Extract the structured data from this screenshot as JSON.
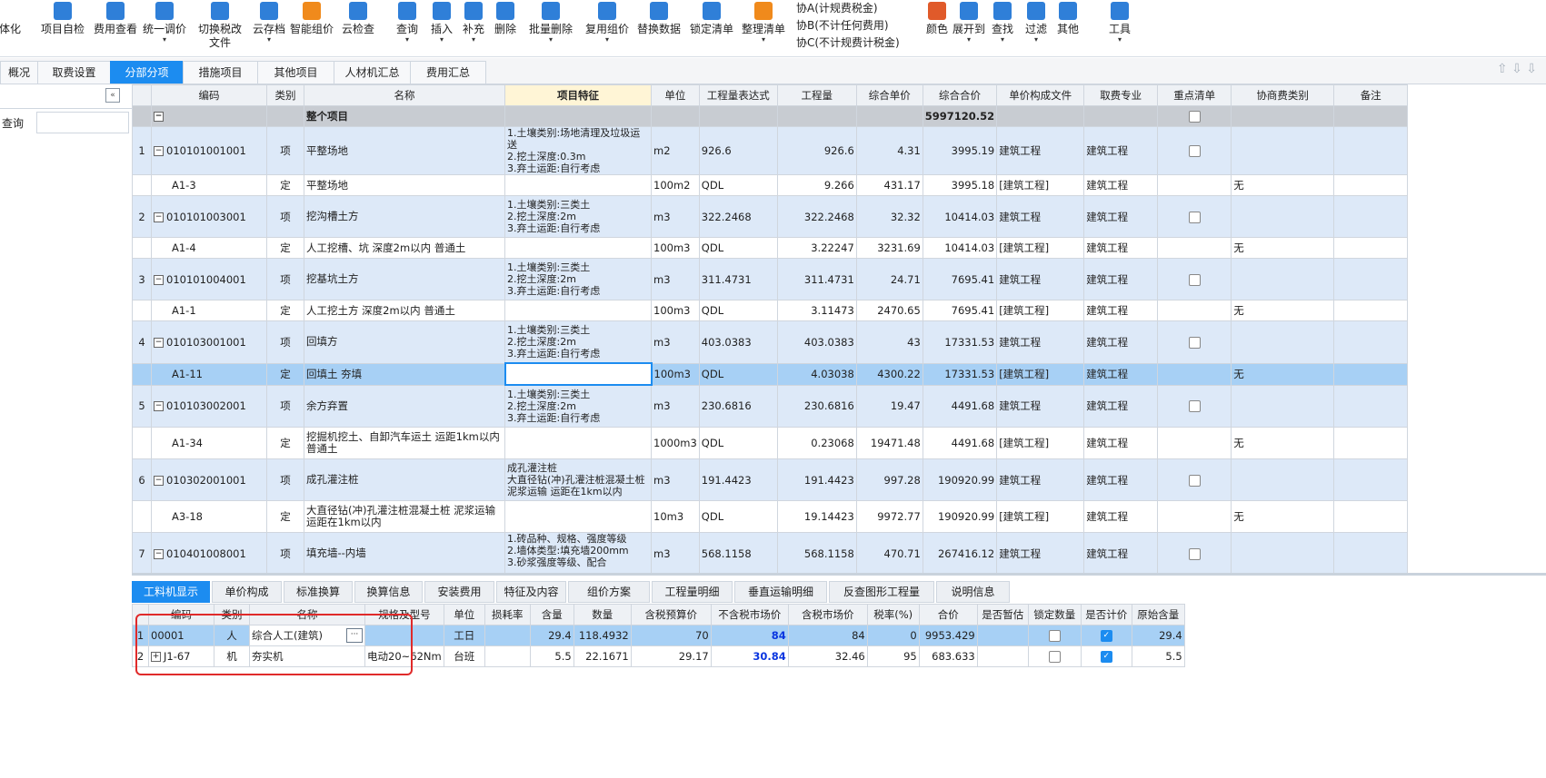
{
  "toolbar": {
    "buttons": [
      {
        "label": "体化",
        "color": "#2f7fd8"
      },
      {
        "label": "项目自检",
        "color": "#2f7fd8"
      },
      {
        "label": "费用查看",
        "color": "#2f7fd8"
      },
      {
        "label": "统一调价",
        "color": "#2f7fd8"
      },
      {
        "label": "切换税改",
        "label2": "文件",
        "color": "#2f7fd8"
      },
      {
        "label": "云存档",
        "color": "#2f7fd8"
      },
      {
        "label": "智能组价",
        "color": "#f08a1c"
      },
      {
        "label": "云检查",
        "color": "#2f7fd8"
      },
      {
        "label": "查询",
        "color": "#2f7fd8"
      },
      {
        "label": "插入",
        "color": "#2f7fd8"
      },
      {
        "label": "补充",
        "color": "#2f7fd8"
      },
      {
        "label": "删除",
        "color": "#2f7fd8"
      },
      {
        "label": "批量删除",
        "color": "#2f7fd8"
      },
      {
        "label": "复用组价",
        "color": "#2f7fd8"
      },
      {
        "label": "替换数据",
        "color": "#2f7fd8"
      },
      {
        "label": "锁定清单",
        "color": "#2f7fd8"
      },
      {
        "label": "整理清单",
        "color": "#f08a1c"
      },
      {
        "label": "颜色",
        "color": "#e05a2a"
      },
      {
        "label": "展开到",
        "color": "#2f7fd8"
      },
      {
        "label": "查找",
        "color": "#2f7fd8"
      },
      {
        "label": "过滤",
        "color": "#2f7fd8"
      },
      {
        "label": "其他",
        "color": "#2f7fd8"
      },
      {
        "label": "工具",
        "color": "#2f7fd8"
      }
    ],
    "xie": [
      "协A(计规费税金)",
      "协B(不计任何费用)",
      "协C(不计规费计税金)"
    ]
  },
  "tabs": [
    "概况",
    "取费设置",
    "分部分项",
    "措施项目",
    "其他项目",
    "人材机汇总",
    "费用汇总"
  ],
  "left_panel": {
    "query_label": "查询",
    "collapse": "«"
  },
  "grid": {
    "headers": [
      "编码",
      "类别",
      "名称",
      "项目特征",
      "单位",
      "工程量表达式",
      "工程量",
      "综合单价",
      "综合合价",
      "单价构成文件",
      "取费专业",
      "重点清单",
      "协商费类别",
      "备注"
    ],
    "total_row": {
      "toggle": "−",
      "name": "整个项目",
      "total": "5997120.52"
    },
    "rows": [
      {
        "idx": "1",
        "code": "010101001001",
        "type": "项",
        "name": "平整场地",
        "feat": "1.土壤类别:场地清理及垃圾运送\n2.挖土深度:0.3m\n3.弃土运距:自行考虑",
        "unit": "m2",
        "expr": "926.6",
        "qty": "926.6",
        "price": "4.31",
        "total": "3995.19",
        "file": "建筑工程",
        "major": "建筑工程"
      },
      {
        "code": "A1-3",
        "type": "定",
        "name": "平整场地",
        "unit": "100m2",
        "expr": "QDL",
        "qty": "9.266",
        "price": "431.17",
        "total": "3995.18",
        "file": "[建筑工程]",
        "major": "建筑工程",
        "xie": "无"
      },
      {
        "idx": "2",
        "code": "010101003001",
        "type": "项",
        "name": "挖沟槽土方",
        "feat": "1.土壤类别:三类土\n2.挖土深度:2m\n3.弃土运距:自行考虑",
        "unit": "m3",
        "expr": "322.2468",
        "qty": "322.2468",
        "price": "32.32",
        "total": "10414.03",
        "file": "建筑工程",
        "major": "建筑工程"
      },
      {
        "code": "A1-4",
        "type": "定",
        "name": "人工挖槽、坑 深度2m以内 普通土",
        "unit": "100m3",
        "expr": "QDL",
        "qty": "3.22247",
        "price": "3231.69",
        "total": "10414.03",
        "file": "[建筑工程]",
        "major": "建筑工程",
        "xie": "无"
      },
      {
        "idx": "3",
        "code": "010101004001",
        "type": "项",
        "name": "挖基坑土方",
        "feat": "1.土壤类别:三类土\n2.挖土深度:2m\n3.弃土运距:自行考虑",
        "unit": "m3",
        "expr": "311.4731",
        "qty": "311.4731",
        "price": "24.71",
        "total": "7695.41",
        "file": "建筑工程",
        "major": "建筑工程"
      },
      {
        "code": "A1-1",
        "type": "定",
        "name": "人工挖土方 深度2m以内 普通土",
        "unit": "100m3",
        "expr": "QDL",
        "qty": "3.11473",
        "price": "2470.65",
        "total": "7695.41",
        "file": "[建筑工程]",
        "major": "建筑工程",
        "xie": "无"
      },
      {
        "idx": "4",
        "code": "010103001001",
        "type": "项",
        "name": "回填方",
        "feat": "1.土壤类别:三类土\n2.挖土深度:2m\n3.弃土运距:自行考虑",
        "unit": "m3",
        "expr": "403.0383",
        "qty": "403.0383",
        "price": "43",
        "total": "17331.53",
        "file": "建筑工程",
        "major": "建筑工程"
      },
      {
        "code": "A1-11",
        "type": "定",
        "name": "回填土 夯填",
        "unit": "100m3",
        "expr": "QDL",
        "qty": "4.03038",
        "price": "4300.22",
        "total": "17331.53",
        "file": "[建筑工程]",
        "major": "建筑工程",
        "xie": "无",
        "selected": true
      },
      {
        "idx": "5",
        "code": "010103002001",
        "type": "项",
        "name": "余方弃置",
        "feat": "1.土壤类别:三类土\n2.挖土深度:2m\n3.弃土运距:自行考虑",
        "unit": "m3",
        "expr": "230.6816",
        "qty": "230.6816",
        "price": "19.47",
        "total": "4491.68",
        "file": "建筑工程",
        "major": "建筑工程"
      },
      {
        "code": "A1-34",
        "type": "定",
        "name": "挖掘机挖土、自卸汽车运土 运距1km以内 普通土",
        "unit": "1000m3",
        "expr": "QDL",
        "qty": "0.23068",
        "price": "19471.48",
        "total": "4491.68",
        "file": "[建筑工程]",
        "major": "建筑工程",
        "xie": "无",
        "tall": true
      },
      {
        "idx": "6",
        "code": "010302001001",
        "type": "项",
        "name": "成孔灌注桩",
        "feat": "成孔灌注桩\n大直径钻(冲)孔灌注桩混凝土桩 泥浆运输 运距在1km以内",
        "unit": "m3",
        "expr": "191.4423",
        "qty": "191.4423",
        "price": "997.28",
        "total": "190920.99",
        "file": "建筑工程",
        "major": "建筑工程"
      },
      {
        "code": "A3-18",
        "type": "定",
        "name": "大直径钻(冲)孔灌注桩混凝土桩 泥浆运输 运距在1km以内",
        "unit": "10m3",
        "expr": "QDL",
        "qty": "19.14423",
        "price": "9972.77",
        "total": "190920.99",
        "file": "[建筑工程]",
        "major": "建筑工程",
        "xie": "无",
        "tall": true
      },
      {
        "idx": "7",
        "code": "010401008001",
        "type": "项",
        "name": "填充墙--内墙",
        "feat": "1.砖品种、规格、强度等级\n2.墙体类型:填充墙200mm\n3.砂浆强度等级、配合",
        "unit": "m3",
        "expr": "568.1158",
        "qty": "568.1158",
        "price": "470.71",
        "total": "267416.12",
        "file": "建筑工程",
        "major": "建筑工程"
      }
    ]
  },
  "bottom_tabs": [
    "工料机显示",
    "单价构成",
    "标准换算",
    "换算信息",
    "安装费用",
    "特征及内容",
    "组价方案",
    "工程量明细",
    "垂直运输明细",
    "反查图形工程量",
    "说明信息"
  ],
  "bottom_grid": {
    "headers": [
      "编码",
      "类别",
      "名称",
      "规格及型号",
      "单位",
      "损耗率",
      "含量",
      "数量",
      "含税预算价",
      "不含税市场价",
      "含税市场价",
      "税率(%)",
      "合价",
      "是否暂估",
      "锁定数量",
      "是否计价",
      "原始含量"
    ],
    "rows": [
      {
        "idx": "1",
        "code": "00001",
        "type": "人",
        "name": "综合人工(建筑)",
        "spec": "",
        "unit": "工日",
        "loss": "",
        "content": "29.4",
        "qty": "118.4932",
        "budget": "70",
        "market_ex": "84",
        "market_in": "84",
        "tax": "0",
        "total": "9953.429",
        "orig": "29.4"
      },
      {
        "idx": "2",
        "code": "J1-67",
        "type": "机",
        "name": "夯实机",
        "spec": "电动20~62Nm",
        "unit": "台班",
        "loss": "",
        "content": "5.5",
        "qty": "22.1671",
        "budget": "29.17",
        "market_ex": "30.84",
        "market_in": "32.46",
        "tax": "95",
        "total": "683.633",
        "orig": "5.5"
      }
    ]
  }
}
